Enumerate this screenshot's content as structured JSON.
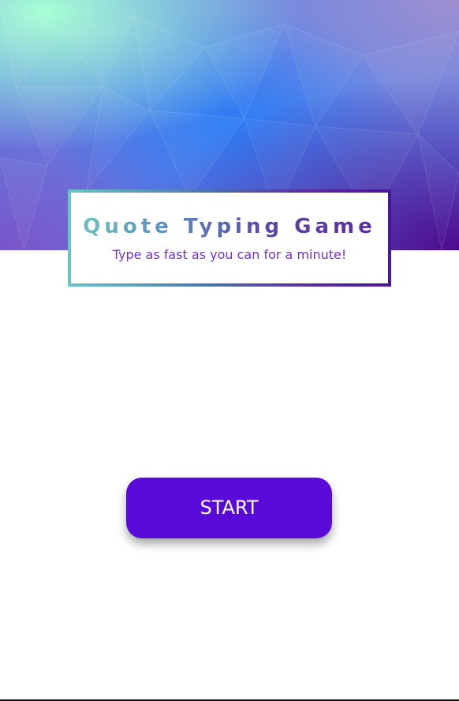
{
  "header": {
    "title": "Quote Typing Game",
    "subtitle": "Type as fast as you can for a minute!"
  },
  "controls": {
    "start_label": "START"
  },
  "colors": {
    "button": "#5a0ad8",
    "subtitle": "#7a2fd0",
    "title_gradient_start": "#6fc9c1",
    "title_gradient_end": "#5a2a9e"
  }
}
